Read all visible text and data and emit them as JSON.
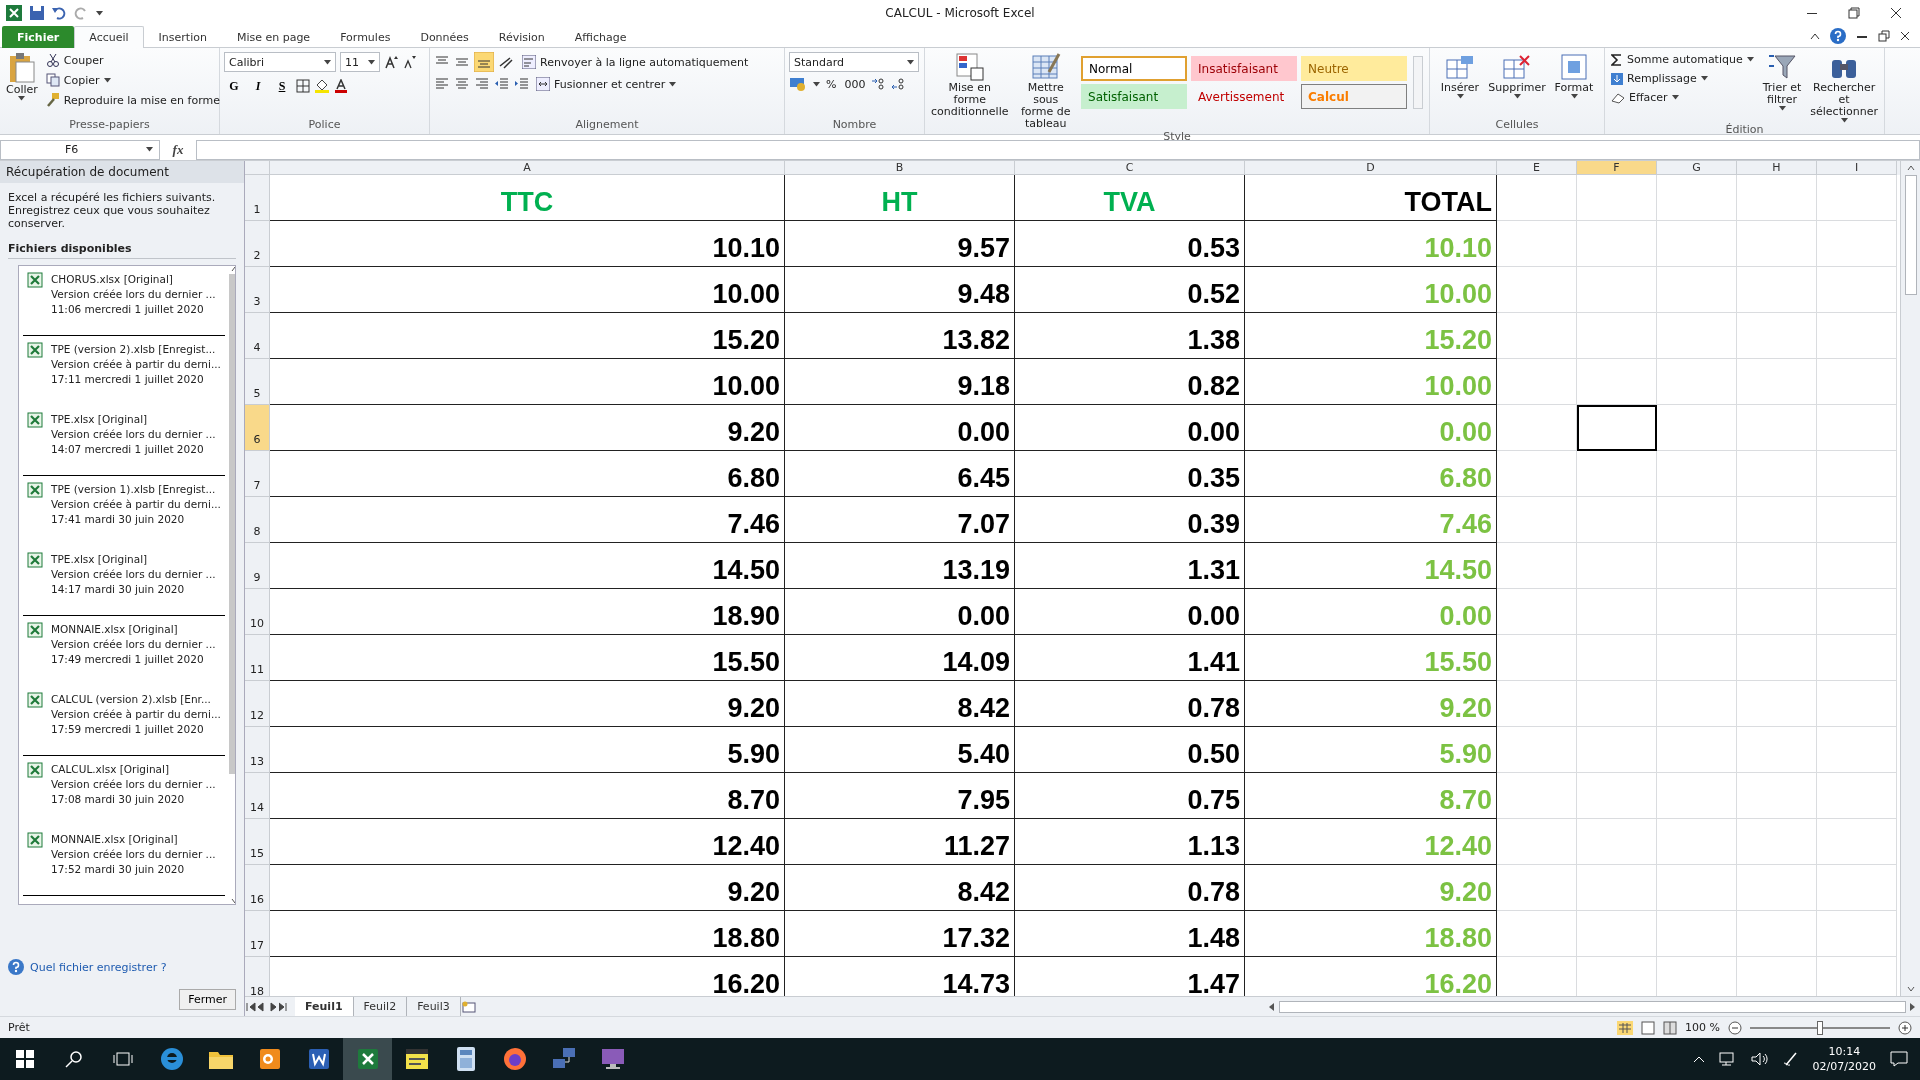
{
  "window": {
    "title": "CALCUL - Microsoft Excel"
  },
  "ribbon_tabs": [
    {
      "label": "Fichier",
      "kind": "file",
      "selected": false
    },
    {
      "label": "Accueil",
      "kind": "tab",
      "selected": true
    },
    {
      "label": "Insertion",
      "kind": "tab",
      "selected": false
    },
    {
      "label": "Mise en page",
      "kind": "tab",
      "selected": false
    },
    {
      "label": "Formules",
      "kind": "tab",
      "selected": false
    },
    {
      "label": "Données",
      "kind": "tab",
      "selected": false
    },
    {
      "label": "Révision",
      "kind": "tab",
      "selected": false
    },
    {
      "label": "Affichage",
      "kind": "tab",
      "selected": false
    }
  ],
  "ribbon": {
    "clipboard": {
      "label": "Presse-papiers",
      "paste": "Coller",
      "cut": "Couper",
      "copy": "Copier",
      "format_painter": "Reproduire la mise en forme"
    },
    "font": {
      "label": "Police",
      "font_name": "Calibri",
      "font_size": "11",
      "bold": "G",
      "italic": "I",
      "underline": "S"
    },
    "alignment": {
      "label": "Alignement",
      "wrap": "Renvoyer à la ligne automatiquement",
      "merge": "Fusionner et centrer"
    },
    "number": {
      "label": "Nombre",
      "format": "Standard",
      "percent": "%",
      "thousands": "000"
    },
    "styles": {
      "label": "Style",
      "conditional": "Mise en forme conditionnelle",
      "table": "Mettre sous forme de tableau",
      "gallery": [
        {
          "label": "Normal",
          "kind": "normal",
          "selected": true
        },
        {
          "label": "Insatisfaisant",
          "kind": "bad",
          "selected": false
        },
        {
          "label": "Neutre",
          "kind": "neutral",
          "selected": false
        },
        {
          "label": "Satisfaisant",
          "kind": "good",
          "selected": false
        },
        {
          "label": "Avertissement",
          "kind": "warning",
          "selected": false
        },
        {
          "label": "Calcul",
          "kind": "calc",
          "selected": false
        }
      ]
    },
    "cells": {
      "label": "Cellules",
      "buttons": [
        {
          "label": "Insérer",
          "kind": "insert"
        },
        {
          "label": "Supprimer",
          "kind": "delete"
        },
        {
          "label": "Format",
          "kind": "format"
        }
      ]
    },
    "editing": {
      "label": "Édition",
      "autosum": "Somme automatique",
      "fill": "Remplissage",
      "clear": "Effacer",
      "sort": "Trier et filtrer",
      "find": "Rechercher et sélectionner"
    }
  },
  "formula_bar": {
    "name_box": "F6",
    "function_label": "fx"
  },
  "recovery_panel": {
    "title": "Récupération de document",
    "message": "Excel a récupéré les fichiers suivants. Enregistrez ceux que vous souhaitez conserver.",
    "section": "Fichiers disponibles",
    "files": [
      {
        "name": "CHORUS.xlsx  [Original]",
        "description": "Version créée lors du dernier ...",
        "time": "11:06 mercredi 1 juillet 2020"
      },
      {
        "name": "TPE (version 2).xlsb  [Enregist...",
        "description": "Version créée à partir du derni...",
        "time": "17:11 mercredi 1 juillet 2020"
      },
      {
        "name": "TPE.xlsx  [Original]",
        "description": "Version créée lors du dernier ...",
        "time": "14:07 mercredi 1 juillet 2020"
      },
      {
        "name": "TPE (version 1).xlsb  [Enregist...",
        "description": "Version créée à partir du derni...",
        "time": "17:41 mardi 30 juin 2020"
      },
      {
        "name": "TPE.xlsx  [Original]",
        "description": "Version créée lors du dernier ...",
        "time": "14:17 mardi 30 juin 2020"
      },
      {
        "name": "MONNAIE.xlsx  [Original]",
        "description": "Version créée lors du dernier ...",
        "time": "17:49 mercredi 1 juillet 2020"
      },
      {
        "name": "CALCUL (version 2).xlsb  [Enr...",
        "description": "Version créée à partir du derni...",
        "time": "17:59 mercredi 1 juillet 2020"
      },
      {
        "name": "CALCUL.xlsx  [Original]",
        "description": "Version créée lors du dernier ...",
        "time": "17:08 mardi 30 juin 2020"
      },
      {
        "name": "MONNAIE.xlsx  [Original]",
        "description": "Version créée lors du dernier ...",
        "time": "17:52 mardi 30 juin 2020"
      }
    ],
    "help_link": "Quel fichier enregistrer ?",
    "close_button": "Fermer"
  },
  "sheet": {
    "columns": [
      {
        "label": "A",
        "selected": false
      },
      {
        "label": "B",
        "selected": false
      },
      {
        "label": "C",
        "selected": false
      },
      {
        "label": "D",
        "selected": false
      },
      {
        "label": "E",
        "selected": false
      },
      {
        "label": "F",
        "selected": true
      },
      {
        "label": "G",
        "selected": false
      },
      {
        "label": "H",
        "selected": false
      },
      {
        "label": "I",
        "selected": false
      }
    ],
    "header_row": {
      "number": "1",
      "cells": [
        "TTC",
        "HT",
        "TVA",
        "TOTAL"
      ]
    },
    "rows": [
      {
        "number": "2",
        "selected": false,
        "cells": [
          "10.10",
          "9.57",
          "0.53",
          "10.10"
        ]
      },
      {
        "number": "3",
        "selected": false,
        "cells": [
          "10.00",
          "9.48",
          "0.52",
          "10.00"
        ]
      },
      {
        "number": "4",
        "selected": false,
        "cells": [
          "15.20",
          "13.82",
          "1.38",
          "15.20"
        ]
      },
      {
        "number": "5",
        "selected": false,
        "cells": [
          "10.00",
          "9.18",
          "0.82",
          "10.00"
        ]
      },
      {
        "number": "6",
        "selected": true,
        "cells": [
          "9.20",
          "0.00",
          "0.00",
          "0.00"
        ]
      },
      {
        "number": "7",
        "selected": false,
        "cells": [
          "6.80",
          "6.45",
          "0.35",
          "6.80"
        ]
      },
      {
        "number": "8",
        "selected": false,
        "cells": [
          "7.46",
          "7.07",
          "0.39",
          "7.46"
        ]
      },
      {
        "number": "9",
        "selected": false,
        "cells": [
          "14.50",
          "13.19",
          "1.31",
          "14.50"
        ]
      },
      {
        "number": "10",
        "selected": false,
        "cells": [
          "18.90",
          "0.00",
          "0.00",
          "0.00"
        ]
      },
      {
        "number": "11",
        "selected": false,
        "cells": [
          "15.50",
          "14.09",
          "1.41",
          "15.50"
        ]
      },
      {
        "number": "12",
        "selected": false,
        "cells": [
          "9.20",
          "8.42",
          "0.78",
          "9.20"
        ]
      },
      {
        "number": "13",
        "selected": false,
        "cells": [
          "5.90",
          "5.40",
          "0.50",
          "5.90"
        ]
      },
      {
        "number": "14",
        "selected": false,
        "cells": [
          "8.70",
          "7.95",
          "0.75",
          "8.70"
        ]
      },
      {
        "number": "15",
        "selected": false,
        "cells": [
          "12.40",
          "11.27",
          "1.13",
          "12.40"
        ]
      },
      {
        "number": "16",
        "selected": false,
        "cells": [
          "9.20",
          "8.42",
          "0.78",
          "9.20"
        ]
      },
      {
        "number": "17",
        "selected": false,
        "cells": [
          "18.80",
          "17.32",
          "1.48",
          "18.80"
        ]
      },
      {
        "number": "18",
        "selected": false,
        "cells": [
          "16.20",
          "14.73",
          "1.47",
          "16.20"
        ]
      }
    ]
  },
  "sheet_tabs": [
    {
      "label": "Feuil1",
      "selected": true
    },
    {
      "label": "Feuil2",
      "selected": false
    },
    {
      "label": "Feuil3",
      "selected": false
    }
  ],
  "status_bar": {
    "status": "Prêt",
    "zoom": "100 %",
    "zoom_slider": {
      "level": 0.5
    }
  },
  "taskbar": {
    "apps": [
      {
        "kind": "edge",
        "selected": false
      },
      {
        "kind": "folder",
        "selected": false
      },
      {
        "kind": "outlook",
        "selected": false
      },
      {
        "kind": "word",
        "selected": false
      },
      {
        "kind": "excel",
        "selected": true
      },
      {
        "kind": "notes",
        "selected": false
      },
      {
        "kind": "calculator",
        "selected": false
      },
      {
        "kind": "firefox",
        "selected": false
      },
      {
        "kind": "network",
        "selected": false
      },
      {
        "kind": "monitor",
        "selected": false
      }
    ],
    "time": "10:14",
    "date": "02/07/2020"
  }
}
